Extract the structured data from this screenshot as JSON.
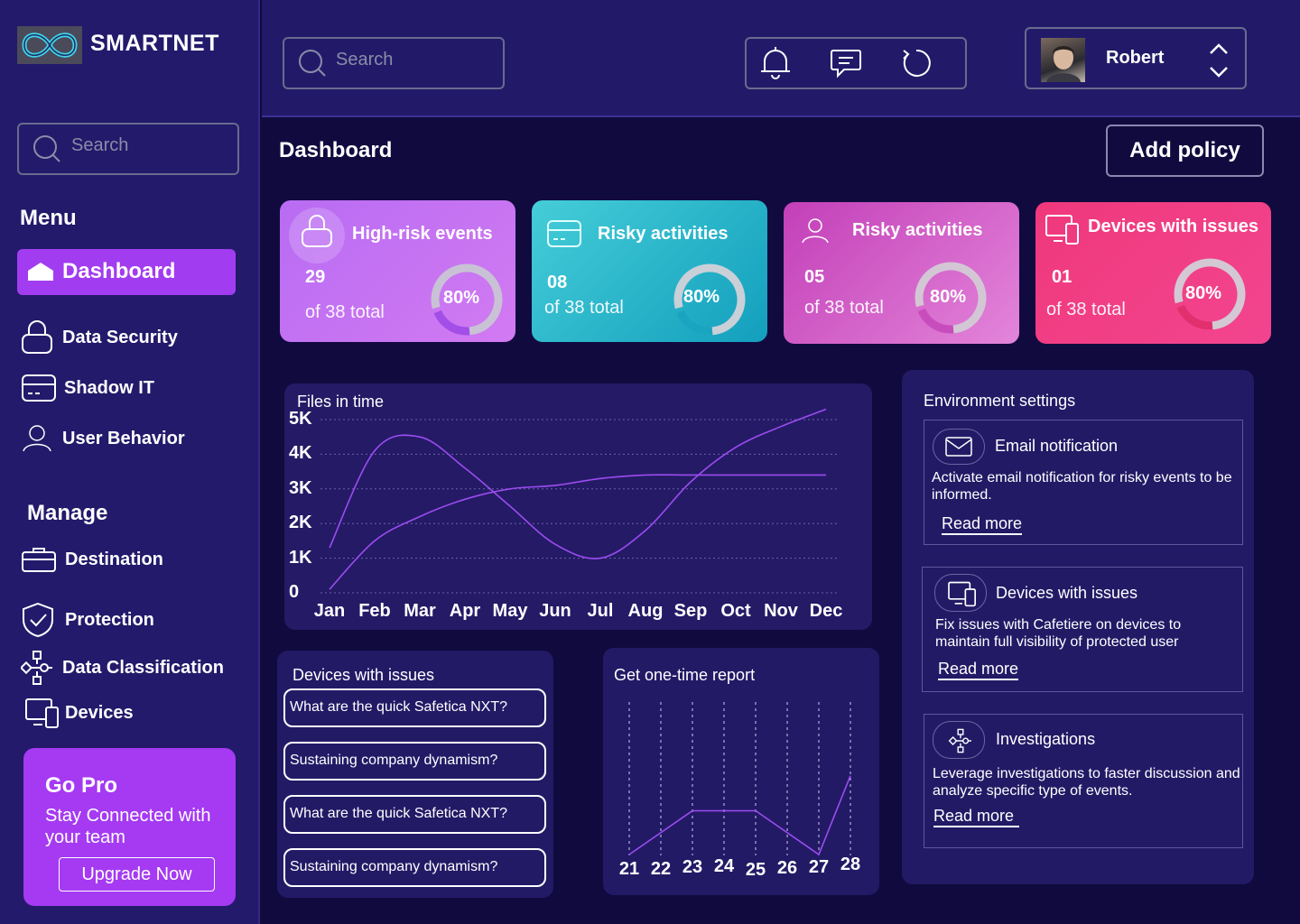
{
  "brand": {
    "name": "SMARTNET"
  },
  "sidebar": {
    "search_placeholder": "Search",
    "menu_title": "Menu",
    "menu_items": [
      {
        "label": "Dashboard",
        "icon": "home-icon",
        "active": true
      },
      {
        "label": "Data Security",
        "icon": "lock-icon"
      },
      {
        "label": "Shadow  IT",
        "icon": "card-icon"
      },
      {
        "label": "User Behavior",
        "icon": "user-icon"
      }
    ],
    "manage_title": "Manage",
    "manage_items": [
      {
        "label": "Destination",
        "icon": "briefcase-icon"
      },
      {
        "label": "Protection",
        "icon": "shield-icon"
      },
      {
        "label": "Data Classification",
        "icon": "network-icon"
      },
      {
        "label": "Devices",
        "icon": "devices-icon"
      }
    ],
    "gopro": {
      "title": "Go Pro",
      "text": "Stay Connected with your team",
      "button": "Upgrade Now"
    }
  },
  "header": {
    "search_placeholder": "Search",
    "icons": [
      "bell-icon",
      "message-icon",
      "refresh-icon"
    ],
    "user": {
      "name": "Robert"
    }
  },
  "page": {
    "title": "Dashboard",
    "add_policy": "Add policy"
  },
  "stats": [
    {
      "title": "High-risk events",
      "count": "29",
      "total": "of 38 total",
      "percent": "80%",
      "progress": 0.8,
      "icon": "lock-icon",
      "color": "#c36cf2"
    },
    {
      "title": "Risky activities",
      "count": "08",
      "total": "of 38 total",
      "percent": "80%",
      "progress": 0.8,
      "icon": "card-icon",
      "color": "#2bb6c9"
    },
    {
      "title": "Risky activities",
      "count": "05",
      "total": "of 38 total",
      "percent": "80%",
      "progress": 0.8,
      "icon": "user-icon",
      "color": "#d659c8"
    },
    {
      "title": "Devices with issues",
      "count": "01",
      "total": "of 38 total",
      "percent": "80%",
      "progress": 0.8,
      "icon": "devices-icon",
      "color": "#f0357f"
    }
  ],
  "files_chart": {
    "title": "Files in time",
    "y_ticks": [
      "5K",
      "4K",
      "3K",
      "2K",
      "1K",
      "0"
    ],
    "months": [
      "Jan",
      "Feb",
      "Mar",
      "Apr",
      "May",
      "Jun",
      "Jul",
      "Aug",
      "Sep",
      "Oct",
      "Nov",
      "Dec"
    ]
  },
  "devices_panel": {
    "title": "Devices with issues",
    "questions": [
      "What are the quick Safetica NXT?",
      "Sustaining company dynamism?",
      "What are the quick Safetica NXT?",
      "Sustaining company dynamism?"
    ]
  },
  "report_chart": {
    "title": "Get one-time report",
    "days": [
      "21",
      "22",
      "23",
      "24",
      "25",
      "26",
      "27",
      "28"
    ]
  },
  "environment": {
    "title": "Environment settings",
    "items": [
      {
        "title": "Email notification",
        "desc": "Activate email notification for risky events to be informed.",
        "link": "Read more",
        "icon": "mail-icon"
      },
      {
        "title": "Devices with issues",
        "desc": "Fix issues with Cafetiere on devices to maintain full visibility of protected user",
        "link": "Read more",
        "icon": "devices-icon"
      },
      {
        "title": "Investigations",
        "desc": "Leverage investigations to faster discussion and analyze specific type of events.",
        "link": "Read more",
        "icon": "network-icon"
      }
    ]
  },
  "chart_data": [
    {
      "type": "line",
      "title": "Files in time",
      "categories": [
        "Jan",
        "Feb",
        "Mar",
        "Apr",
        "May",
        "Jun",
        "Jul",
        "Aug",
        "Sep",
        "Oct",
        "Nov",
        "Dec"
      ],
      "series": [
        {
          "values": [
            1300,
            4100,
            4500,
            3600,
            2500,
            1400,
            1000,
            1800,
            3200,
            4200,
            4800,
            5300
          ]
        },
        {
          "values": [
            100,
            1500,
            2200,
            2700,
            3000,
            3100,
            3300,
            3400,
            3400,
            3400,
            3400,
            3400
          ]
        }
      ],
      "ylim": [
        0,
        5000
      ],
      "grid": true
    },
    {
      "type": "line",
      "title": "Get one-time report",
      "categories": [
        "21",
        "22",
        "23",
        "24",
        "25",
        "26",
        "27",
        "28"
      ],
      "series": [
        {
          "values": [
            0,
            25,
            50,
            50,
            50,
            25,
            0,
            90
          ]
        }
      ],
      "grid": true
    }
  ]
}
